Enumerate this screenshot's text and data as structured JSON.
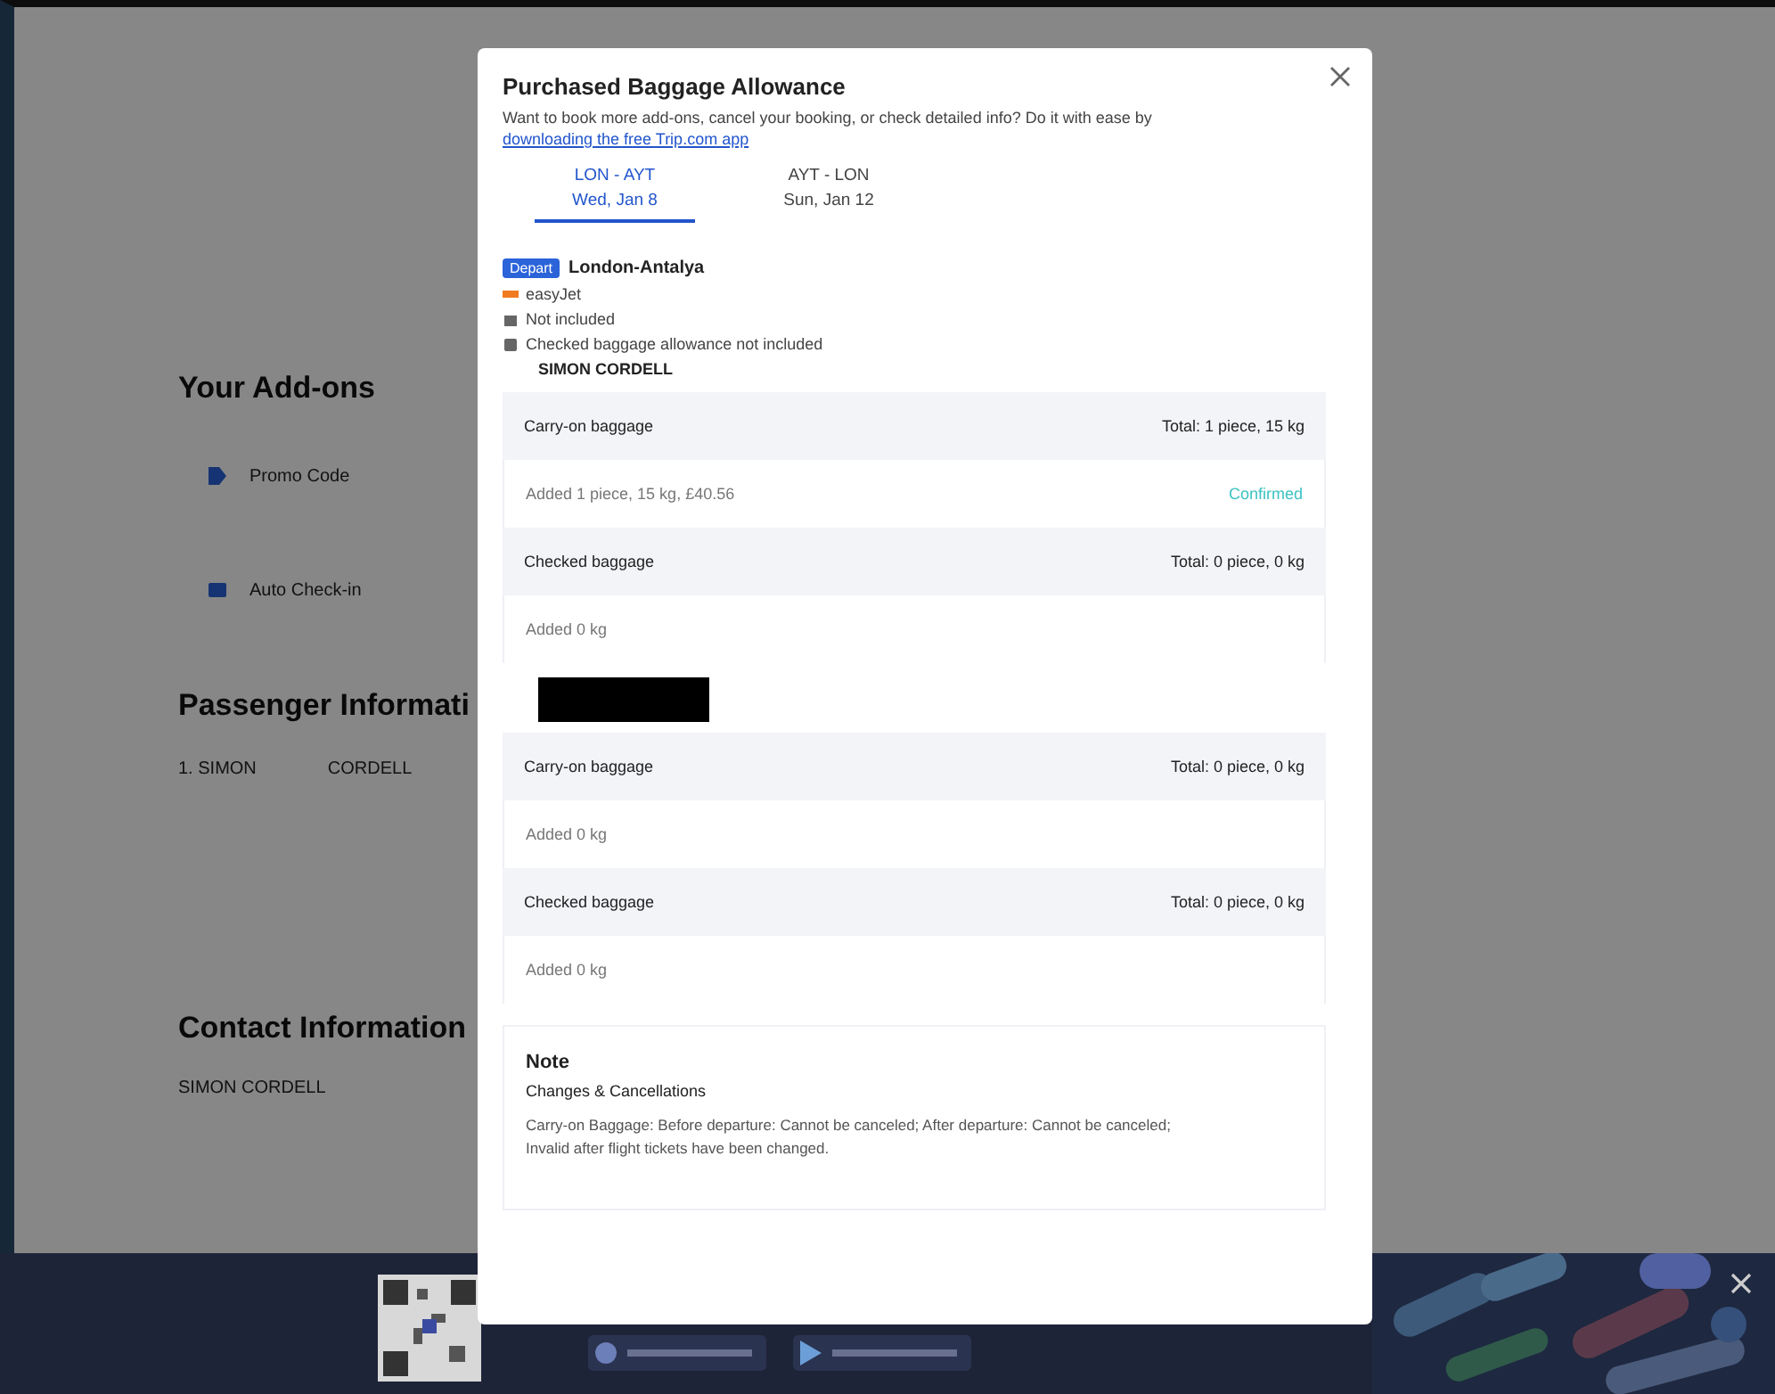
{
  "page": {
    "addons_title": "Your Add-ons",
    "addons": [
      {
        "name": "Promo Code",
        "kind": "promo"
      },
      {
        "name": "Auto Check-in",
        "kind": "checkin"
      }
    ],
    "passenger_title": "Passenger Informati",
    "passenger_first": "1. SIMON",
    "passenger_last": "CORDELL",
    "contact_title": "Contact Information",
    "contact_name": "SIMON CORDELL"
  },
  "modal": {
    "title": "Purchased Baggage Allowance",
    "intro": "Want to book more add-ons, cancel your booking, or check detailed info? Do it with ease by",
    "intro_link": "downloading the free Trip.com app",
    "tabs": [
      {
        "route": "LON - AYT",
        "date": "Wed, Jan 8",
        "selected": true
      },
      {
        "route": "AYT - LON",
        "date": "Sun, Jan 12",
        "selected": false
      }
    ],
    "segment": {
      "badge": "Depart",
      "route": "London-Antalya",
      "airline": "easyJet",
      "carry_on": "Not included",
      "checked": "Checked baggage allowance not included",
      "passenger": "SIMON CORDELL"
    },
    "groups": [
      {
        "redacted": false,
        "items": [
          {
            "title": "Carry-on baggage",
            "total": "Total: 1 piece, 15 kg",
            "added": "Added 1 piece,  15 kg,  £40.56",
            "status": "Confirmed"
          },
          {
            "title": "Checked baggage",
            "total": "Total: 0 piece, 0 kg",
            "added": "Added 0 kg"
          }
        ]
      },
      {
        "redacted": true,
        "items": [
          {
            "title": "Carry-on baggage",
            "total": "Total: 0 piece, 0 kg",
            "added": "Added 0 kg"
          },
          {
            "title": "Checked baggage",
            "total": "Total: 0 piece, 0 kg",
            "added": "Added 0 kg"
          }
        ]
      }
    ],
    "note": {
      "title": "Note",
      "subtitle": "Changes & Cancellations",
      "text": "Carry-on Baggage: Before departure: Cannot be canceled; After departure: Cannot be canceled; Invalid after flight tickets have been changed."
    }
  }
}
